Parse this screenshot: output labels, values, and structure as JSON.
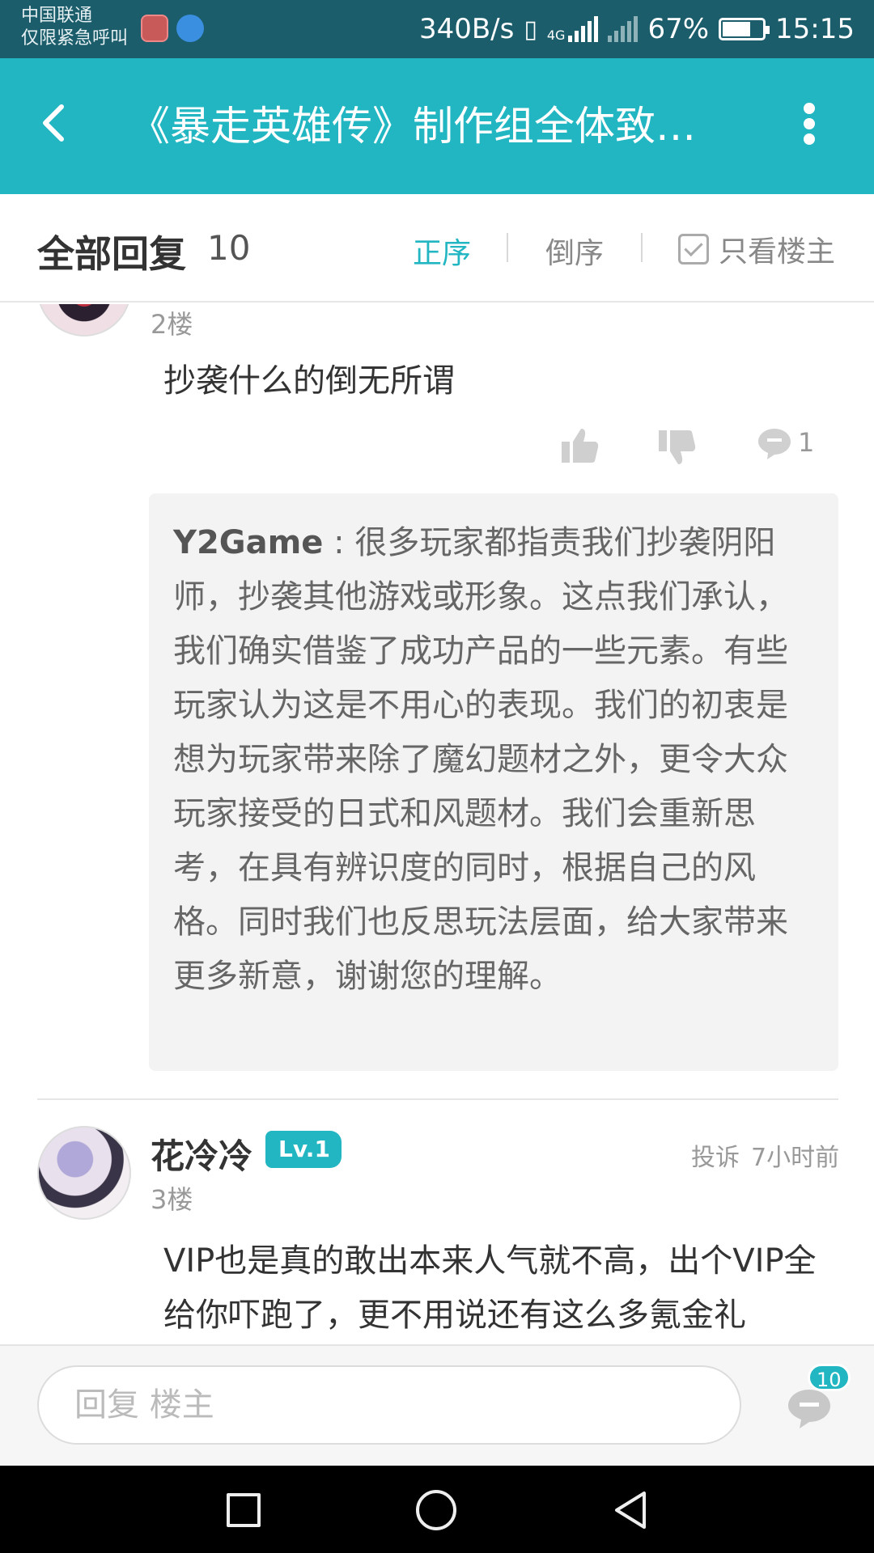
{
  "status_bar": {
    "carrier_line1": "中国联通",
    "carrier_line2": "仅限紧急呼叫",
    "net_speed": "340B/s",
    "network_type": "4G",
    "battery": "67%",
    "time": "15:15"
  },
  "app_bar": {
    "title": "《暴走英雄传》制作组全体致…",
    "back_icon": "back-arrow-icon",
    "more_icon": "more-vertical-icon"
  },
  "filter_bar": {
    "all_replies_label": "全部回复",
    "reply_count": "10",
    "sort_asc_label": "正序",
    "sort_desc_label": "倒序",
    "only_op_label": "只看楼主",
    "active_color": "#21b6c2"
  },
  "posts": [
    {
      "floor": "2楼",
      "content": "抄袭什么的倒无所谓",
      "comment_count": "1",
      "reply": {
        "author": "Y2Game",
        "separator": " : ",
        "text": "很多玩家都指责我们抄袭阴阳师，抄袭其他游戏或形象。这点我们承认，我们确实借鉴了成功产品的一些元素。有些玩家认为这是不用心的表现。我们的初衷是想为玩家带来除了魔幻题材之外，更令大众玩家接受的日式和风题材。我们会重新思考，在具有辨识度的同时，根据自己的风格。同时我们也反思玩法层面，给大家带来更多新意，谢谢您的理解。"
      }
    },
    {
      "username": "花冷冷",
      "level": "Lv.1",
      "report_label": "投诉",
      "time": "7小时前",
      "floor": "3楼",
      "content": "VIP也是真的敢出本来人气就不高，出个VIP全给你吓跑了，更不用说还有这么多氪金礼"
    }
  ],
  "bottom_bar": {
    "reply_placeholder": "回复  楼主",
    "badge_count": "10"
  },
  "colors": {
    "status_bar": "#1b5d6b",
    "app_bar": "#21b6c2",
    "reply_bg": "#f3f3f3"
  }
}
